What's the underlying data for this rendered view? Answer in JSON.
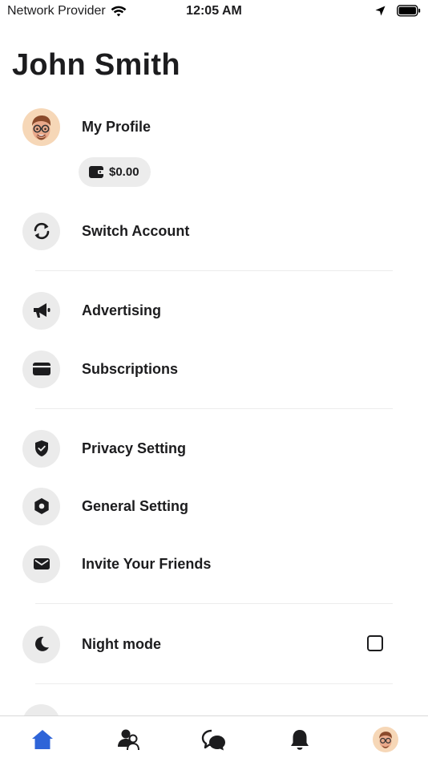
{
  "status": {
    "carrier": "Network Provider",
    "time": "12:05 AM"
  },
  "header": {
    "title": "John Smith"
  },
  "menu": {
    "profile": {
      "label": "My Profile",
      "icon": "avatar-memoji"
    },
    "wallet": {
      "balance": "$0.00",
      "icon": "wallet-icon"
    },
    "switch_account": {
      "label": "Switch Account",
      "icon": "refresh-icon"
    },
    "advertising": {
      "label": "Advertising",
      "icon": "megaphone-icon"
    },
    "subscriptions": {
      "label": "Subscriptions",
      "icon": "card-icon"
    },
    "privacy": {
      "label": "Privacy Setting",
      "icon": "shield-check-icon"
    },
    "general": {
      "label": "General Setting",
      "icon": "hexagon-gear-icon"
    },
    "invite": {
      "label": "Invite Your Friends",
      "icon": "envelope-icon"
    },
    "night_mode": {
      "label": "Night mode",
      "icon": "moon-icon",
      "checked": false
    }
  },
  "tabbar": {
    "items": [
      {
        "name": "home",
        "icon": "home-icon",
        "active": true
      },
      {
        "name": "friends",
        "icon": "people-icon",
        "active": false
      },
      {
        "name": "messages",
        "icon": "chat-icon",
        "active": false
      },
      {
        "name": "notifications",
        "icon": "bell-icon",
        "active": false
      },
      {
        "name": "profile",
        "icon": "avatar-memoji",
        "active": false
      }
    ]
  },
  "colors": {
    "active_tab": "#2e64d8",
    "icon_bg": "#ebebeb",
    "avatar_bg": "#f6d7b7",
    "text": "#1c1c1e"
  }
}
